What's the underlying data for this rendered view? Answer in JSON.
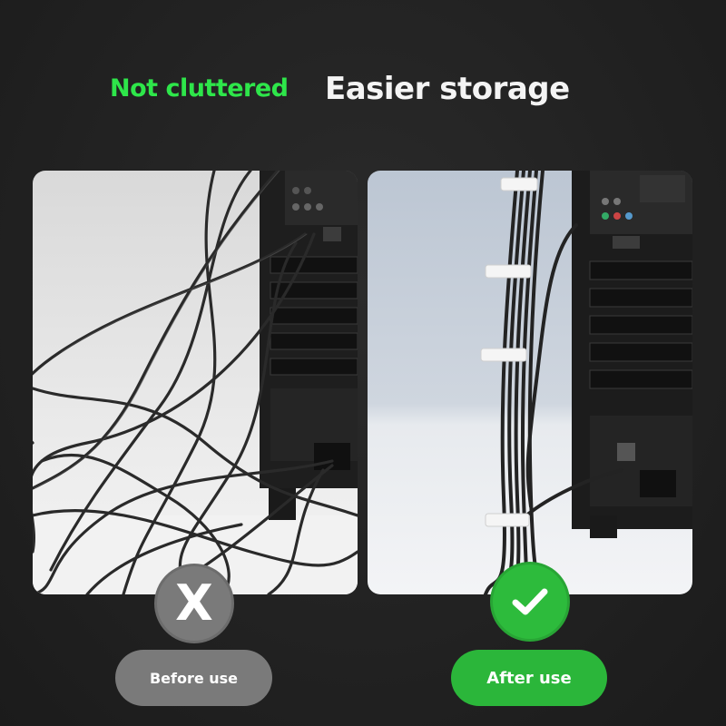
{
  "headline": {
    "green_text": "Not cluttered",
    "white_text": "Easier storage"
  },
  "panels": {
    "left": {
      "icon": "x-mark-icon",
      "badge_symbol": "X",
      "label": "Before use"
    },
    "right": {
      "icon": "checkmark-icon",
      "badge_symbol": "✓",
      "label": "After use"
    }
  },
  "colors": {
    "background": "#222222",
    "accent_green": "#2ee64a",
    "button_green": "#2bb63a",
    "button_gray": "#7a7a7a",
    "headline_white": "#f4f4f4"
  }
}
